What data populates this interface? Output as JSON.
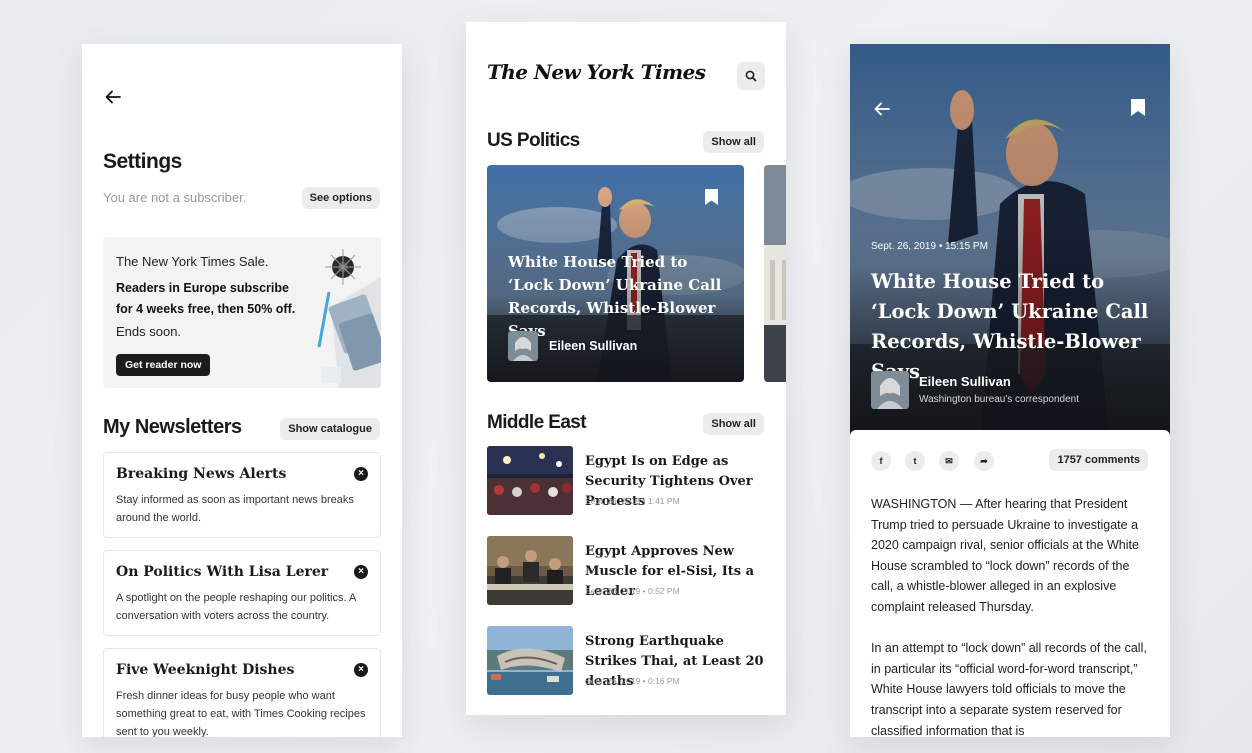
{
  "settings": {
    "title": "Settings",
    "subscriber_text": "You are not a subscriber.",
    "see_options_label": "See options",
    "promo": {
      "line1": "The New York Times Sale.",
      "line2": "Readers in Europe subscribe for 4 weeks free, then 50% off.",
      "line3": "Ends soon.",
      "cta_label": "Get reader now"
    },
    "newsletters_title": "My Newsletters",
    "show_catalogue_label": "Show catalogue",
    "newsletters": [
      {
        "title": "Breaking News Alerts",
        "desc": "Stay informed as soon as important news breaks around the world."
      },
      {
        "title": "On Politics With Lisa Lerer",
        "desc": "A spotlight on the people reshaping our politics. A conversation with voters across the country."
      },
      {
        "title": "Five Weeknight Dishes",
        "desc": "Fresh dinner ideas for busy people who want something great to eat, with Times Cooking recipes sent to you weekly."
      }
    ]
  },
  "home": {
    "logo": "The New York Times",
    "section1": {
      "title": "US Politics",
      "show_all_label": "Show all"
    },
    "hero": {
      "title": "White House Tried to ‘Lock Down’ Ukraine Call Records, Whistle-Blower Says",
      "author": "Eileen Sullivan"
    },
    "section2": {
      "title": "Middle East",
      "show_all_label": "Show all"
    },
    "stories": [
      {
        "title": "Egypt Is on Edge as Security Tightens Over Protests",
        "meta": "Sept. 26, 2019  •  1:41 PM"
      },
      {
        "title": "Egypt Approves New Muscle for el-Sisi, Its a Leader",
        "meta": "Sept. 26, 2019  •  0:52 PM"
      },
      {
        "title": "Strong Earthquake Strikes Thai, at Least 20 deaths",
        "meta": "Sept. 26, 2019  •  0:16 PM"
      }
    ]
  },
  "article": {
    "meta": "Sept. 26, 2019  •  15:15 PM",
    "title": "White House Tried to ‘Lock Down’ Ukraine Call Records, Whistle-Blower Says",
    "author": "Eileen Sullivan",
    "role": "Washington bureau's correspondent",
    "share": {
      "facebook": "f",
      "twitter": "t",
      "email": "✉",
      "forward": "➦"
    },
    "comments_label": "1757 comments",
    "paragraphs": [
      "WASHINGTON — After hearing that President Trump tried to persuade Ukraine to investigate a 2020 campaign rival, senior officials at the White House scrambled to “lock down” records of the call, a whistle-blower alleged in an explosive complaint released Thursday.",
      "In an attempt to “lock down” all records of the call, in particular its “official word-for-word transcript,” White House lawyers told officials to move the transcript into a separate system reserved for classified information that is"
    ]
  }
}
